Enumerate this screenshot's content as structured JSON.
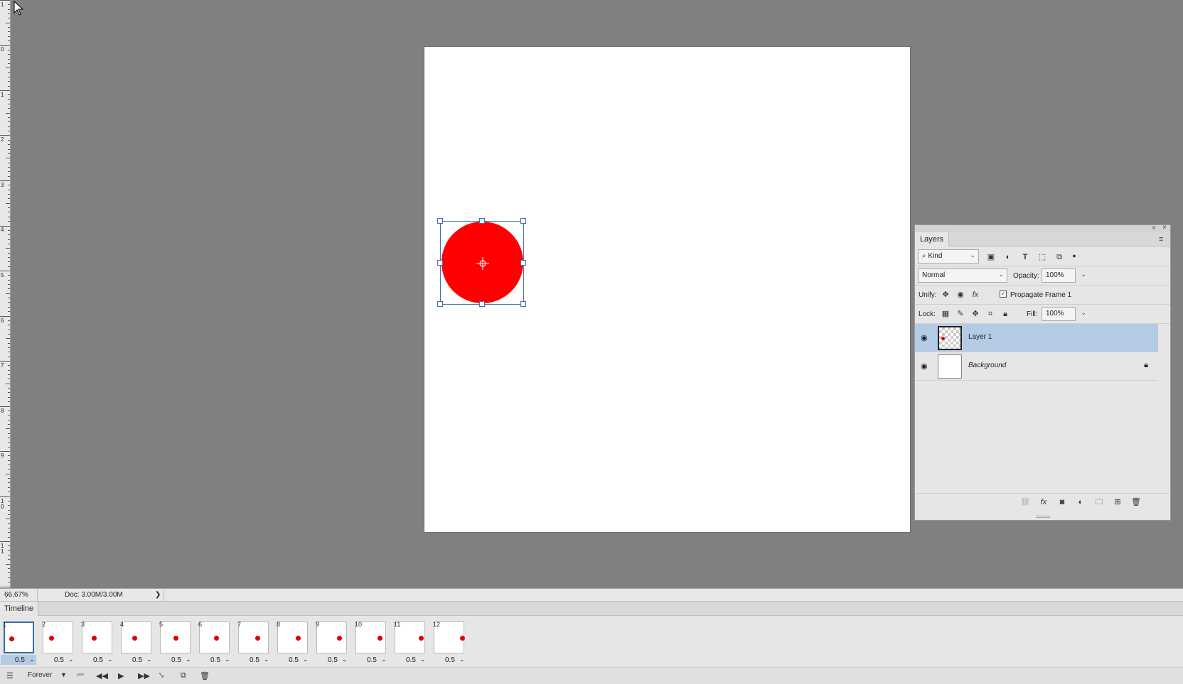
{
  "canvas": {
    "zoom": "66.67%",
    "doc_info": "Doc: 3.00M/3.00M",
    "shape_color": "#ff0000"
  },
  "ruler": {
    "labels": [
      "1",
      "0",
      "1",
      "2",
      "3",
      "4",
      "5",
      "6",
      "7",
      "8",
      "9",
      "1\n0",
      "1\n1"
    ]
  },
  "layers_panel": {
    "tab_title": "Layers",
    "filter_kind": "Kind",
    "blend_mode": "Normal",
    "opacity_label": "Opacity:",
    "opacity_value": "100%",
    "unify_label": "Unify:",
    "propagate_label": "Propagate Frame 1",
    "lock_label": "Lock:",
    "fill_label": "Fill:",
    "fill_value": "100%",
    "layers": [
      {
        "name": "Layer 1",
        "selected": true
      },
      {
        "name": "Background",
        "selected": false,
        "locked": true
      }
    ]
  },
  "timeline": {
    "tab_title": "Timeline",
    "loop": "Forever",
    "frames": [
      {
        "num": "1",
        "delay": "0.5"
      },
      {
        "num": "2",
        "delay": "0.5"
      },
      {
        "num": "3",
        "delay": "0.5"
      },
      {
        "num": "4",
        "delay": "0.5"
      },
      {
        "num": "5",
        "delay": "0.5"
      },
      {
        "num": "6",
        "delay": "0.5"
      },
      {
        "num": "7",
        "delay": "0.5"
      },
      {
        "num": "8",
        "delay": "0.5"
      },
      {
        "num": "9",
        "delay": "0.5"
      },
      {
        "num": "10",
        "delay": "0.5"
      },
      {
        "num": "11",
        "delay": "0.5"
      },
      {
        "num": "12",
        "delay": "0.5"
      }
    ]
  }
}
